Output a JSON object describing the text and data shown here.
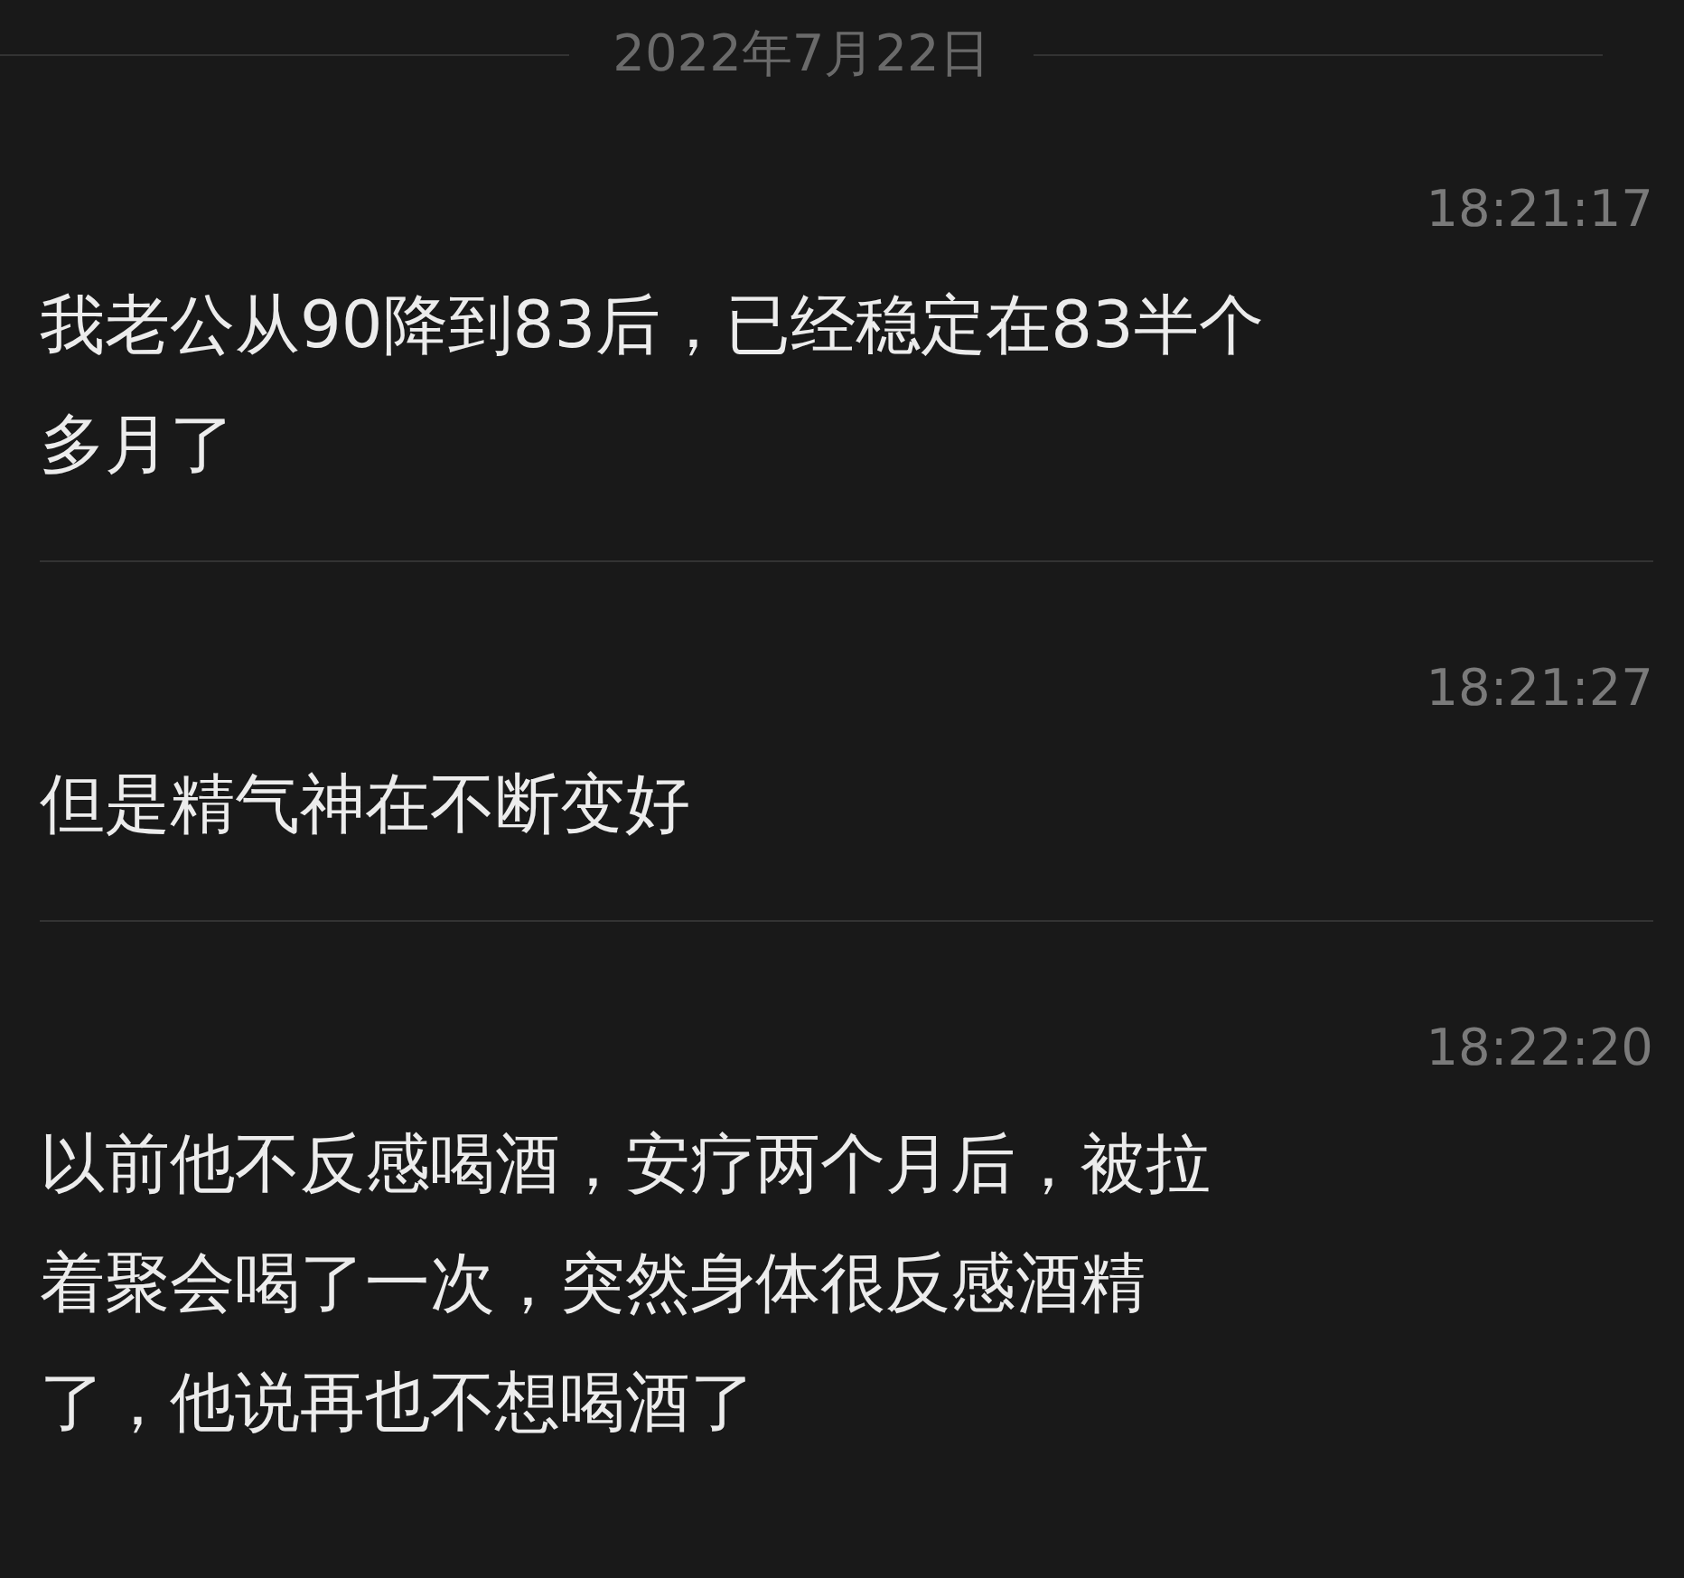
{
  "date_separator": "2022年7月22日",
  "messages": [
    {
      "time": "18:21:17",
      "lines": [
        "我老公从90降到83后，已经稳定在83半个",
        "多月了"
      ]
    },
    {
      "time": "18:21:27",
      "lines": [
        "但是精气神在不断变好"
      ]
    },
    {
      "time": "18:22:20",
      "lines": [
        "以前他不反感喝酒，安疗两个月后，被拉",
        "着聚会喝了一次，突然身体很反感酒精",
        "了，他说再也不想喝酒了"
      ]
    }
  ]
}
